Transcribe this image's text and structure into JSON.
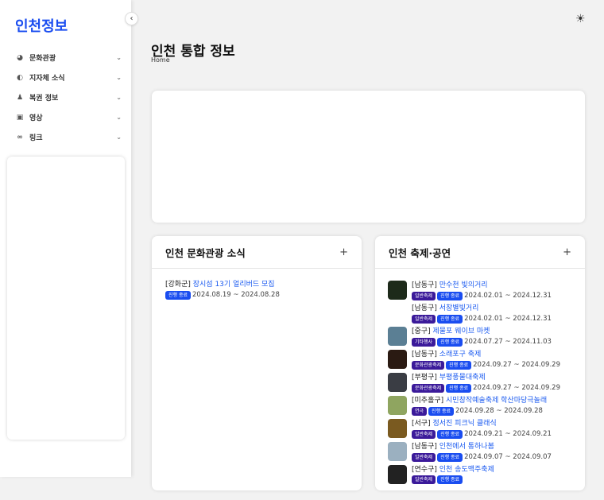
{
  "sidebar": {
    "logo": "인천정보",
    "collapse_icon": "‹",
    "items": [
      {
        "icon": "◕",
        "label": "문화관광"
      },
      {
        "icon": "◐",
        "label": "지자체 소식"
      },
      {
        "icon": "♟",
        "label": "복권 정보"
      },
      {
        "icon": "▣",
        "label": "영상"
      },
      {
        "icon": "∞",
        "label": "링크"
      }
    ],
    "chevron": "⌄"
  },
  "header": {
    "theme_icon": "☀",
    "title": "인천 통합 정보",
    "breadcrumb": "Home"
  },
  "culture": {
    "title": "인천 문화관광 소식",
    "add": "+",
    "items": [
      {
        "region": "[강화군]",
        "title": "장시섬 13기 얼리버드 모집",
        "status": "진행 종료",
        "dates": "2024.08.19 ~ 2024.08.28"
      }
    ]
  },
  "festival": {
    "title": "인천 축제·공연",
    "add": "+",
    "items": [
      {
        "region": "[남동구]",
        "title": "만수천 빛의거리",
        "category": "일반축제",
        "status": "진행 종료",
        "dates": "2024.02.01 ~ 2024.12.31",
        "thumb": "#1d2a1a"
      },
      {
        "region": "[남동구]",
        "title": "서창별빛거리",
        "category": "일반축제",
        "status": "진행 종료",
        "dates": "2024.02.01 ~ 2024.12.31",
        "thumb": ""
      },
      {
        "region": "[중구]",
        "title": "제물포 웨이브 마켓",
        "category": "기타행사",
        "status": "진행 종료",
        "dates": "2024.07.27 ~ 2024.11.03",
        "thumb": "#5b7f94"
      },
      {
        "region": "[남동구]",
        "title": "소래포구 축제",
        "category": "문화관광축제",
        "status": "진행 종료",
        "dates": "2024.09.27 ~ 2024.09.29",
        "thumb": "#2a1a12"
      },
      {
        "region": "[부평구]",
        "title": "부평풍물대축제",
        "category": "문화관광축제",
        "status": "진행 종료",
        "dates": "2024.09.27 ~ 2024.09.29",
        "thumb": "#3a3d44"
      },
      {
        "region": "[미추홀구]",
        "title": "시민창작예술축제 학산마당극놀래",
        "category": "연극",
        "status": "진행 종료",
        "dates": "2024.09.28 ~ 2024.09.28",
        "thumb": "#8fa560"
      },
      {
        "region": "[서구]",
        "title": "정서진 피크닉 클래식",
        "category": "일반축제",
        "status": "진행 종료",
        "dates": "2024.09.21 ~ 2024.09.21",
        "thumb": "#7a5a20"
      },
      {
        "region": "[남동구]",
        "title": "인천에서 통하나봄",
        "category": "일반축제",
        "status": "진행 종료",
        "dates": "2024.09.07 ~ 2024.09.07",
        "thumb": "#9bb0c0"
      },
      {
        "region": "[연수구]",
        "title": "인천 송도맥주축제",
        "category": "일반축제",
        "status": "진행 종료",
        "dates": "",
        "thumb": "#222"
      }
    ]
  }
}
